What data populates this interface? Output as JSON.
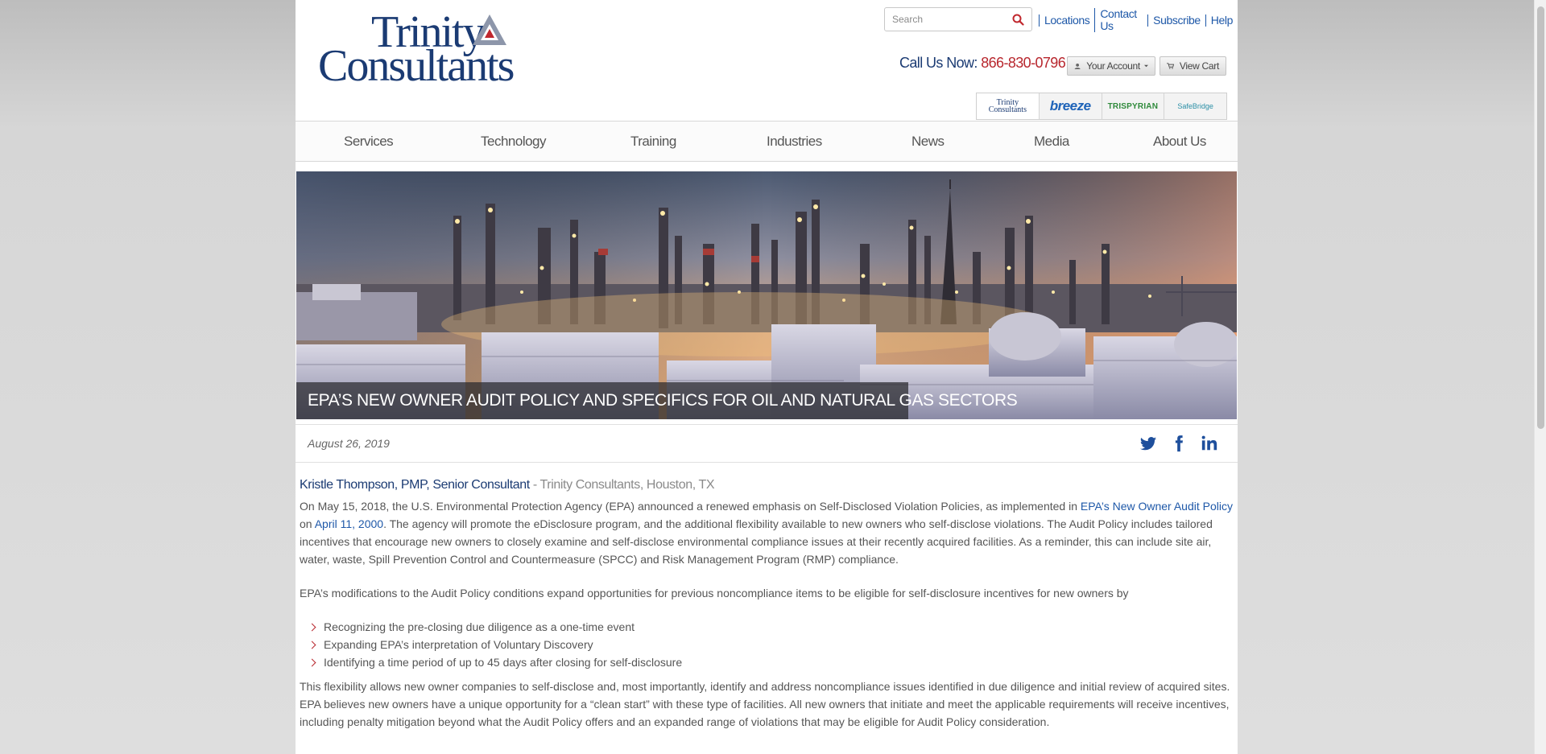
{
  "header": {
    "logo": {
      "line1": "Trinity",
      "line2": "Consultants"
    },
    "search_placeholder": "Search",
    "top_links": [
      "Locations",
      "Contact Us",
      "Subscribe",
      "Help"
    ],
    "call_label": "Call Us Now:",
    "phone": "866-830-0796",
    "account_button": "Your Account",
    "cart_button": "View Cart",
    "brands": [
      "Trinity Consultants",
      "breeze",
      "TRISPYRIAN",
      "SafeBridge"
    ]
  },
  "nav": [
    "Services",
    "Technology",
    "Training",
    "Industries",
    "News",
    "Media",
    "About Us"
  ],
  "hero": {
    "title": "EPA’S NEW OWNER AUDIT POLICY AND SPECIFICS FOR OIL AND NATURAL GAS SECTORS"
  },
  "article": {
    "date": "August 26, 2019",
    "author_name": "Kristle Thompson, PMP, Senior Consultant",
    "author_org": " - Trinity Consultants, Houston, TX",
    "p1_a": "On May 15, 2018, the U.S. Environmental Protection Agency (EPA) announced a renewed emphasis on Self-Disclosed Violation Policies, as implemented in ",
    "p1_link1": "EPA’s New Owner Audit Policy",
    "p1_b": " on ",
    "p1_link2": "April 11, 2000",
    "p1_c": ". The agency will promote the eDisclosure program, and the additional flexibility available to new owners who self-disclose violations. The Audit Policy includes tailored incentives that encourage new owners to closely examine and self-disclose environmental compliance issues at their recently acquired facilities. As a reminder, this can include site air, water, waste, Spill Prevention Control and Countermeasure (SPCC) and Risk Management Program (RMP) compliance.",
    "p2": "EPA’s modifications to the Audit Policy conditions expand opportunities for previous noncompliance items to be eligible for self-disclosure incentives for new owners by",
    "bullets": [
      "Recognizing the pre-closing due diligence as a one-time event",
      "Expanding EPA’s interpretation of Voluntary Discovery",
      "Identifying a time period of up to 45 days after closing for self-disclosure"
    ],
    "p3": "This flexibility allows new owner companies to self-disclose and, most importantly, identify and address noncompliance issues identified in due diligence and initial review of acquired sites. EPA believes new owners have a unique opportunity for a “clean start” with these type of facilities. All new owners that initiate and meet the applicable requirements will receive incentives, including penalty mitigation beyond what the Audit Policy offers and an expanded range of violations that may be eligible for Audit Policy consideration."
  },
  "colors": {
    "brand_navy": "#1b3b73",
    "link_blue": "#1e58a8",
    "accent_red": "#b8272e"
  }
}
